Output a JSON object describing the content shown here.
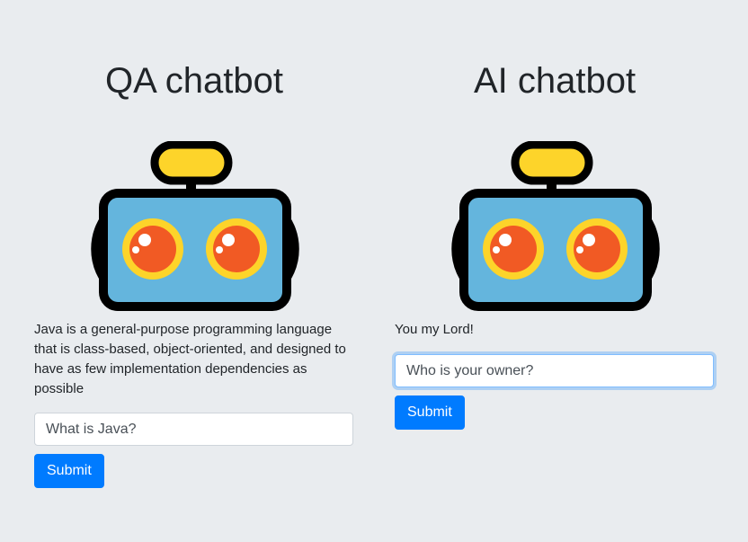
{
  "left": {
    "title": "QA chatbot",
    "answer": "Java is a general-purpose programming language that is class-based, object-oriented, and designed to have as few implementation dependencies as possible",
    "input_value": "What is Java?",
    "submit_label": "Submit"
  },
  "right": {
    "title": "AI chatbot",
    "answer": "You my Lord!",
    "input_value": "Who is your owner?",
    "submit_label": "Submit"
  },
  "colors": {
    "background": "#e9ecef",
    "primary": "#007bff",
    "robot_body": "#64b5dd",
    "robot_outline": "#000000",
    "robot_antenna": "#fdd42a",
    "robot_eye_ring": "#fdd42a",
    "robot_eye": "#f15a24"
  },
  "icons": {
    "robot": "robot-icon"
  }
}
